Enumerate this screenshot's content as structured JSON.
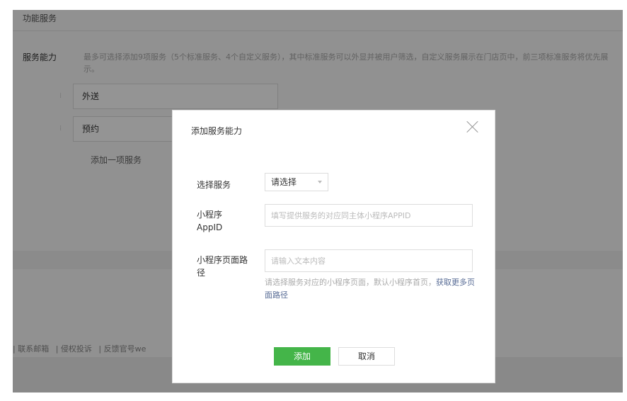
{
  "background": {
    "section_title": "功能服务",
    "service_label": "服务能力",
    "service_desc": "最多可选择添加9项服务（5个标准服务、4个自定义服务），其中标准服务可以外显并被用户筛选，自定义服务展示在门店页中，前三项标准服务将优先展示。",
    "items": [
      {
        "label": "外送"
      },
      {
        "label": "预约"
      }
    ],
    "add_label": "添加一项服务",
    "footer": {
      "link1": "| 联系邮箱",
      "link2": "| 侵权投诉",
      "link3": "| 反馈官号we"
    }
  },
  "dialog": {
    "title": "添加服务能力",
    "select_label": "选择服务",
    "select_value": "请选择",
    "appid_label": "小程序AppID",
    "appid_placeholder": "填写提供服务的对应同主体小程序APPID",
    "path_label": "小程序页面路径",
    "path_placeholder": "请输入文本内容",
    "hint_text": "请选择服务对应的小程序页面，默认小程序首页，",
    "hint_link": "获取更多页面路径",
    "confirm_label": "添加",
    "cancel_label": "取消"
  },
  "colors": {
    "primary": "#44b549",
    "link": "#576b95"
  }
}
